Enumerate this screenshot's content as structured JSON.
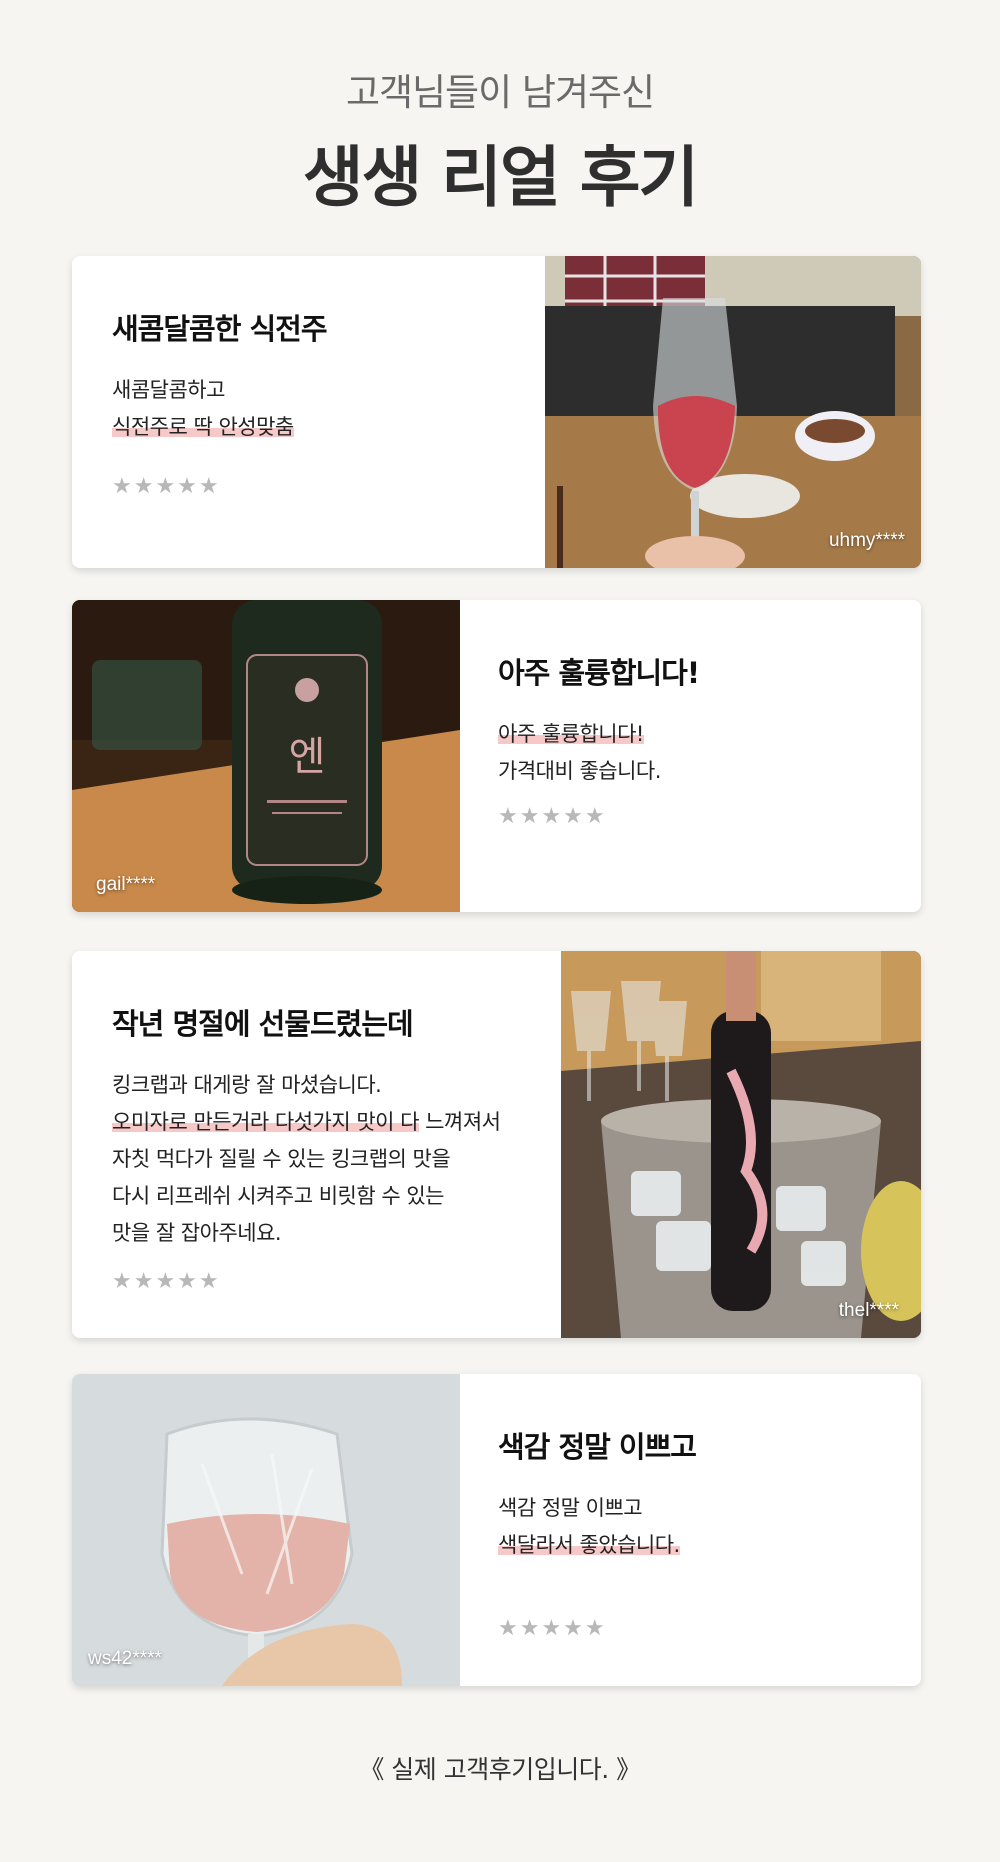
{
  "header": {
    "subtitle": "고객님들이 남겨주신",
    "title": "생생 리얼 후기"
  },
  "reviews": [
    {
      "title": "새콤달콤한 식전주",
      "lines": [
        "새콤달콤하고",
        "식전주로 딱 안성맞춤"
      ],
      "highlight": "식전주로 딱 안성맞춤",
      "stars": "★★★★★",
      "user": "uhmy****",
      "photo": "rose-wine-glass-photo"
    },
    {
      "title": "아주 훌륭합니다!",
      "lines": [
        "아주 훌륭합니다!",
        "가격대비 좋습니다."
      ],
      "highlight": "아주 훌륭합니다!",
      "stars": "★★★★★",
      "user": "gail****",
      "photo": "dark-wine-bottle-photo"
    },
    {
      "title": "작년 명절에 선물드렸는데",
      "line1": "킹크랩과 대게랑 잘 마셨습니다.",
      "line2_hl": "오미자로 만든거라 다섯가지 맛이 다",
      "line2_rest": " 느껴져서",
      "line3": "자칫 먹다가 질릴 수 있는 킹크랩의 맛을",
      "line4": "다시 리프레쉬 시켜주고 비릿함 수 있는",
      "line5": "맛을 잘 잡아주네요.",
      "stars": "★★★★★",
      "user": "thel****",
      "photo": "bottle-in-ice-bucket-photo"
    },
    {
      "title": "색감 정말 이쁘고",
      "lines": [
        "색감 정말 이쁘고",
        "색달라서 좋았습니다."
      ],
      "highlight": "색달라서 좋았습니다.",
      "stars": "★★★★★",
      "user": "ws42****",
      "photo": "crystal-glass-photo"
    }
  ],
  "footer": {
    "note": "《 실제 고객후기입니다. 》"
  }
}
